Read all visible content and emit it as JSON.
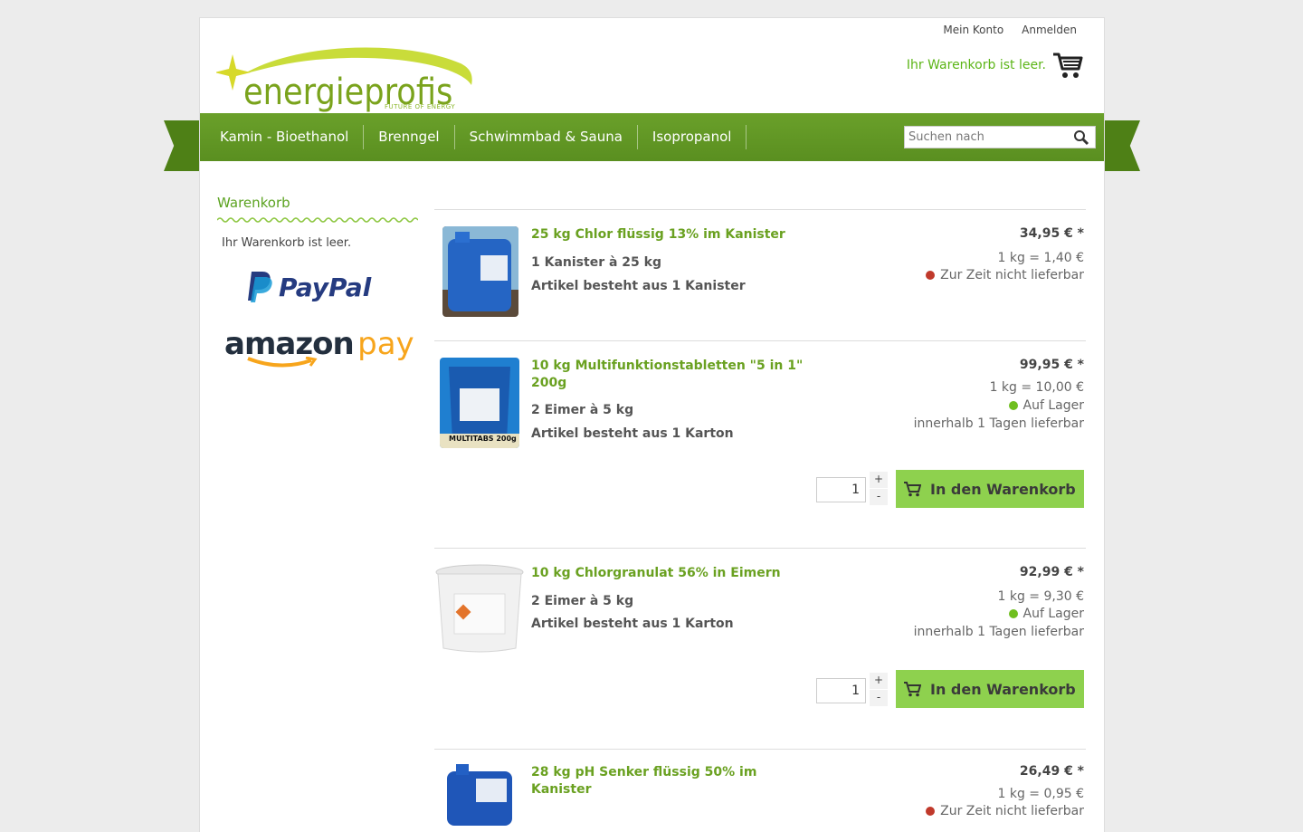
{
  "header": {
    "account_link": "Mein Konto",
    "login_link": "Anmelden",
    "cart_status": "Ihr Warenkorb ist leer.",
    "logo_text": "energieprofis",
    "logo_tagline": "FUTURE OF ENERGY"
  },
  "nav": {
    "items": [
      "Kamin - Bioethanol",
      "Brenngel",
      "Schwimmbad & Sauna",
      "Isopropanol"
    ],
    "search_placeholder": "Suchen nach"
  },
  "sidebar": {
    "title": "Warenkorb",
    "empty_text": "Ihr Warenkorb ist leer.",
    "paypal_label": "PayPal",
    "amazon_label_a": "amazon",
    "amazon_label_b": "pay"
  },
  "products": [
    {
      "name": "25 kg Chlor flüssig 13% im Kanister",
      "pack": "1 Kanister à 25 kg",
      "consists": "Artikel besteht aus 1 Kanister",
      "price": "34,95 € *",
      "unit_price": "1 kg = 1,40 €",
      "availability": "Zur Zeit nicht lieferbar",
      "status_color": "#c0392b"
    },
    {
      "name": "10 kg Multifunktionstabletten \"5 in 1\" 200g",
      "pack": "2 Eimer à 5 kg",
      "consists": "Artikel besteht aus 1 Karton",
      "price": "99,95 € *",
      "unit_price": "1 kg = 10,00 €",
      "availability": "Auf Lager",
      "delivery": "innerhalb 1 Tagen lieferbar",
      "status_color": "#6fbf1f",
      "quantity": "1",
      "buy_label": "In den Warenkorb",
      "image_label": "MULTITABS 200g"
    },
    {
      "name": "10 kg Chlorgranulat 56% in Eimern",
      "pack": "2 Eimer à 5 kg",
      "consists": "Artikel besteht aus 1 Karton",
      "price": "92,99 € *",
      "unit_price": "1 kg = 9,30 €",
      "availability": "Auf Lager",
      "delivery": "innerhalb 1 Tagen lieferbar",
      "status_color": "#6fbf1f",
      "quantity": "1",
      "buy_label": "In den Warenkorb"
    },
    {
      "name": "28 kg pH Senker flüssig 50% im Kanister",
      "price": "26,49 € *",
      "unit_price": "1 kg = 0,95 €",
      "availability": "Zur Zeit nicht lieferbar",
      "status_color": "#c0392b"
    }
  ],
  "stepper": {
    "plus": "+",
    "minus": "-"
  }
}
